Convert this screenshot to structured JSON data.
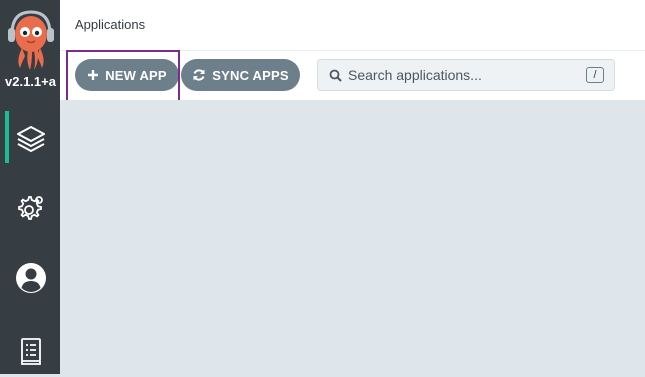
{
  "app": {
    "version": "v2.1.1+a"
  },
  "sidebar": {
    "items": [
      {
        "name": "applications",
        "icon": "layers-icon",
        "active": true
      },
      {
        "name": "settings",
        "icon": "gear-icon",
        "active": false
      },
      {
        "name": "user-info",
        "icon": "user-icon",
        "active": false
      },
      {
        "name": "documentation",
        "icon": "book-icon",
        "active": false
      }
    ]
  },
  "header": {
    "title": "Applications"
  },
  "toolbar": {
    "new_app_label": "NEW APP",
    "sync_apps_label": "SYNC APPS"
  },
  "search": {
    "placeholder": "Search applications...",
    "shortcut": "/"
  },
  "colors": {
    "sidebar_bg": "#363d43",
    "accent": "#18be94",
    "button_bg": "#6d7f8b",
    "content_bg": "#dee6eb",
    "highlight_border": "#7b2d8b"
  }
}
